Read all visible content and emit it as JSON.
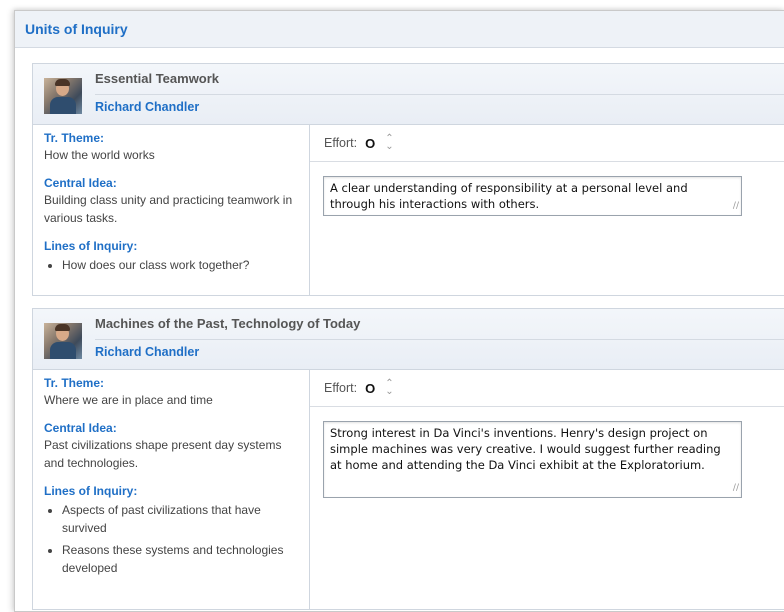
{
  "page": {
    "title": "Units of Inquiry"
  },
  "units": [
    {
      "title": "Essential Teamwork",
      "teacher": "Richard Chandler",
      "theme_label": "Tr. Theme:",
      "theme": "How the world works",
      "central_idea_label": "Central Idea:",
      "central_idea": "Building class unity and practicing teamwork in various tasks.",
      "lines_label": "Lines of Inquiry:",
      "lines": [
        "How does our class work together?"
      ],
      "effort_label": "Effort:",
      "effort_value": "O",
      "comment": "A clear understanding of responsibility at a personal level and through his interactions with others."
    },
    {
      "title": "Machines of the Past, Technology of Today",
      "teacher": "Richard Chandler",
      "theme_label": "Tr. Theme:",
      "theme": "Where we are in place and time",
      "central_idea_label": "Central Idea:",
      "central_idea": "Past civilizations shape present day systems and technologies.",
      "lines_label": "Lines of Inquiry:",
      "lines": [
        "Aspects of past civilizations that have survived",
        "Reasons these systems and technologies developed"
      ],
      "effort_label": "Effort:",
      "effort_value": "O",
      "comment": "Strong interest in Da Vinci's inventions. Henry's design project on simple machines was very creative. I would suggest further reading at home and attending the Da Vinci exhibit at the Exploratorium."
    }
  ]
}
